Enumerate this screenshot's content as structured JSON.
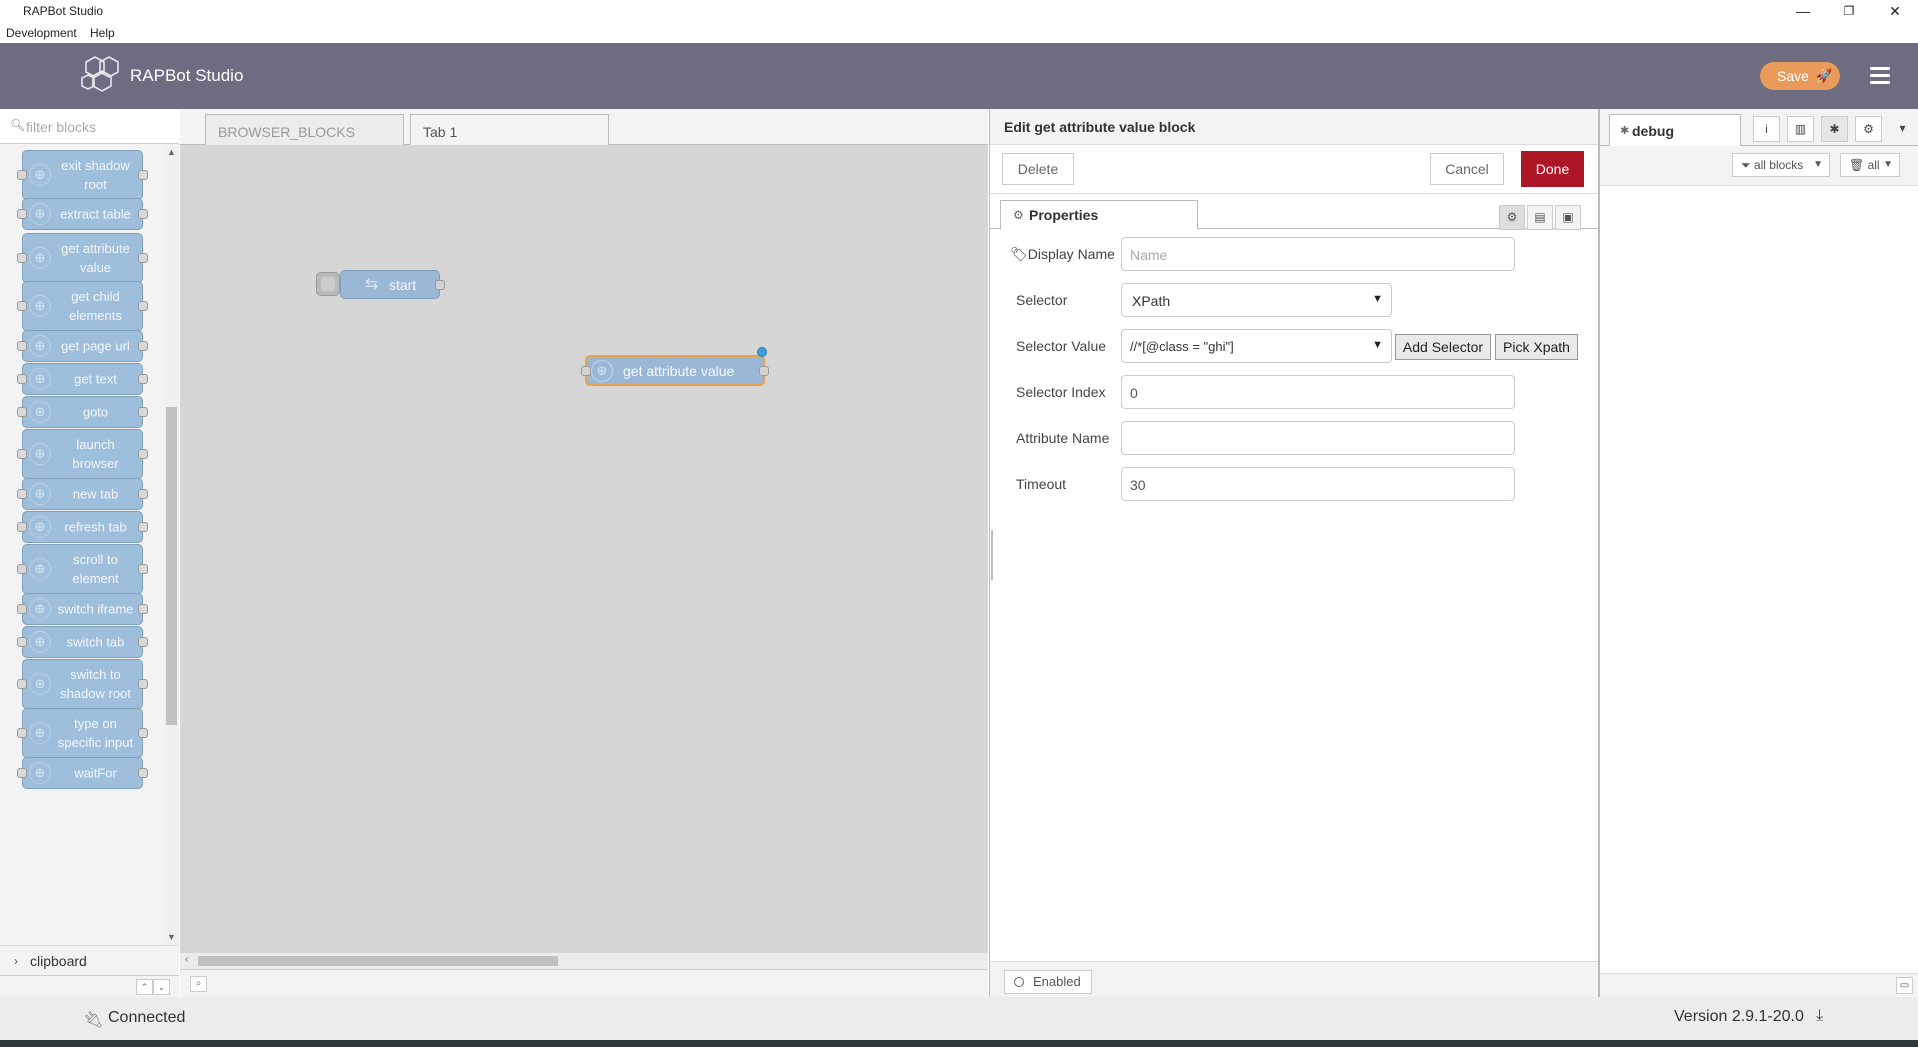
{
  "window": {
    "title": "RAPBot Studio",
    "minimize": "—",
    "restore": "❐",
    "close": "✕"
  },
  "menu": {
    "items": [
      "Development",
      "Help"
    ]
  },
  "header": {
    "brand": "RAPBot Studio",
    "save_label": "Save",
    "save_icon": "🚀"
  },
  "palette": {
    "filter_placeholder": "filter blocks",
    "blocks": [
      "exit shadow root",
      "extract table",
      "get attribute value",
      "get child elements",
      "get page url",
      "get text",
      "goto",
      "launch browser",
      "new tab",
      "refresh tab",
      "scroll to element",
      "switch iframe",
      "switch tab",
      "switch to shadow root",
      "type on specific input",
      "waitFor"
    ],
    "category": "clipboard"
  },
  "workspace": {
    "tabs": [
      "BROWSER_BLOCKS",
      "Tab 1"
    ],
    "nodes": {
      "start": "start",
      "selected": "get attribute value"
    }
  },
  "tray": {
    "title": "Edit get attribute value block",
    "delete_label": "Delete",
    "cancel_label": "Cancel",
    "done_label": "Done",
    "properties_tab": "Properties",
    "fields": {
      "display_name": {
        "label": "Display Name",
        "placeholder": "Name"
      },
      "selector": {
        "label": "Selector",
        "value": "XPath"
      },
      "selector_value": {
        "label": "Selector Value",
        "value": "//*[@class = \"ghi\"]"
      },
      "add_selector": "Add Selector",
      "pick_xpath": "Pick Xpath",
      "selector_index": {
        "label": "Selector Index",
        "value": "0"
      },
      "attribute_name": {
        "label": "Attribute Name",
        "value": ""
      },
      "timeout": {
        "label": "Timeout",
        "value": "30"
      }
    },
    "enabled_label": "Enabled"
  },
  "sidebar": {
    "tab_label": "debug",
    "filter_all_blocks": "all blocks",
    "filter_all": "all"
  },
  "status": {
    "connection": "Connected",
    "version": "Version 2.9.1-20.0"
  },
  "colors": {
    "header": "#6d6c81",
    "save": "#e89b5a",
    "done": "#ad1625",
    "block": "#9ebfdc",
    "selected_outline": "#e9a24a"
  }
}
